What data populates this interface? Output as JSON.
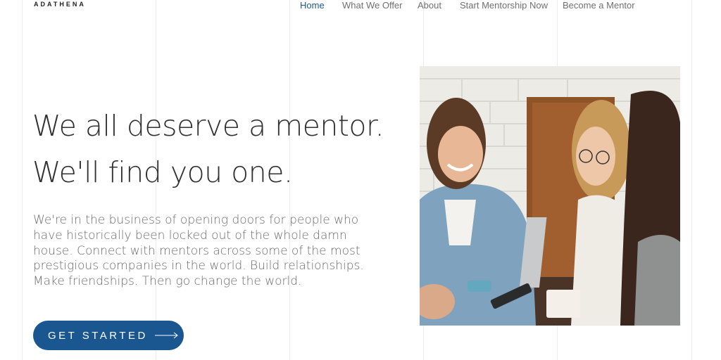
{
  "brand": {
    "logo": "ADATHENA"
  },
  "nav": {
    "items": [
      {
        "label": "Home",
        "active": true
      },
      {
        "label": "What We Offer",
        "active": false
      },
      {
        "label": "About",
        "active": false
      },
      {
        "label": "Start Mentorship Now",
        "active": false
      },
      {
        "label": "Become a Mentor",
        "active": false
      }
    ]
  },
  "hero": {
    "headline_1": "We all deserve a mentor.",
    "headline_2": "We'll find you one.",
    "body": "We're in the business of opening doors for people who have historically been locked out of the whole damn house. Connect with mentors across some of the most prestigious companies in the world. Build relationships. Make friendships. Then go change the world.",
    "cta_label": "GET STARTED",
    "cta_icon": "arrow-right-icon",
    "image": "three-women-laughing-cafe-photo"
  },
  "colors": {
    "accent": "#1a5690",
    "nav_active": "#1a5a96",
    "nav_text": "#707070",
    "heading": "#303030",
    "body_text": "#6b6b6b"
  }
}
